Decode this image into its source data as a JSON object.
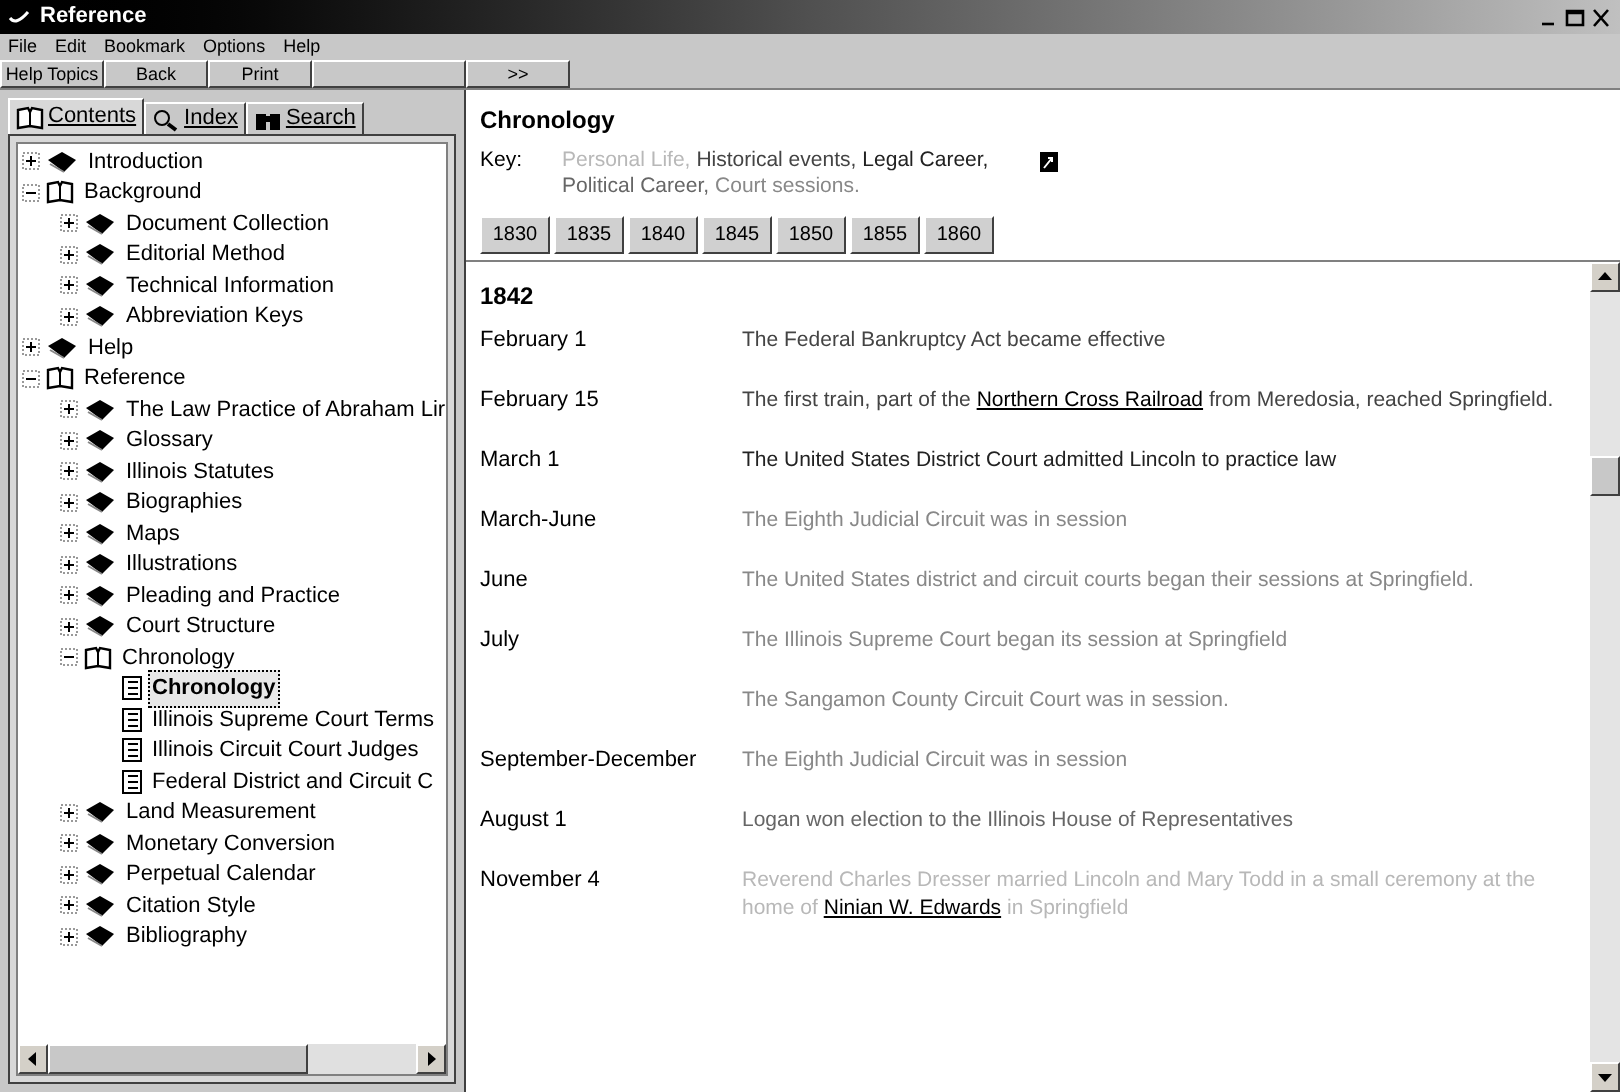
{
  "window": {
    "title": "Reference"
  },
  "menu": [
    "File",
    "Edit",
    "Bookmark",
    "Options",
    "Help"
  ],
  "toolbar": [
    "Help Topics",
    "Back",
    "Print",
    ">>"
  ],
  "tabs": [
    {
      "label": "Contents",
      "selected": true
    },
    {
      "label": "Index",
      "selected": false
    },
    {
      "label": "Search",
      "selected": false
    }
  ],
  "tree": [
    {
      "label": "Introduction",
      "kind": "book",
      "expanded": false,
      "selected": false
    },
    {
      "label": "Background",
      "kind": "book",
      "expanded": true,
      "selected": false,
      "children": [
        {
          "label": "Document Collection",
          "kind": "book",
          "expanded": false,
          "selected": false
        },
        {
          "label": "Editorial Method",
          "kind": "book",
          "expanded": false,
          "selected": false
        },
        {
          "label": "Technical Information",
          "kind": "book",
          "expanded": false,
          "selected": false
        },
        {
          "label": "Abbreviation Keys",
          "kind": "book",
          "expanded": false,
          "selected": false
        }
      ]
    },
    {
      "label": "Help",
      "kind": "book",
      "expanded": false,
      "selected": false
    },
    {
      "label": "Reference",
      "kind": "book",
      "expanded": true,
      "selected": false,
      "children": [
        {
          "label": "The Law Practice of Abraham Lir",
          "kind": "book",
          "expanded": false,
          "selected": false
        },
        {
          "label": "Glossary",
          "kind": "book",
          "expanded": false,
          "selected": false
        },
        {
          "label": "Illinois Statutes",
          "kind": "book",
          "expanded": false,
          "selected": false
        },
        {
          "label": "Biographies",
          "kind": "book",
          "expanded": false,
          "selected": false
        },
        {
          "label": "Maps",
          "kind": "book",
          "expanded": false,
          "selected": false
        },
        {
          "label": "Illustrations",
          "kind": "book",
          "expanded": false,
          "selected": false
        },
        {
          "label": "Pleading and Practice",
          "kind": "book",
          "expanded": false,
          "selected": false
        },
        {
          "label": "Court Structure",
          "kind": "book",
          "expanded": false,
          "selected": false
        },
        {
          "label": "Chronology",
          "kind": "book",
          "expanded": true,
          "selected": false,
          "children": [
            {
              "label": "Chronology",
              "kind": "page",
              "selected": true
            },
            {
              "label": "Illinois Supreme Court Terms",
              "kind": "page",
              "selected": false
            },
            {
              "label": "Illinois Circuit Court Judges",
              "kind": "page",
              "selected": false
            },
            {
              "label": "Federal District and Circuit C",
              "kind": "page",
              "selected": false
            }
          ]
        },
        {
          "label": "Land Measurement",
          "kind": "book",
          "expanded": false,
          "selected": false
        },
        {
          "label": "Monetary Conversion",
          "kind": "book",
          "expanded": false,
          "selected": false
        },
        {
          "label": "Perpetual Calendar",
          "kind": "book",
          "expanded": false,
          "selected": false
        },
        {
          "label": "Citation Style",
          "kind": "book",
          "expanded": false,
          "selected": false
        },
        {
          "label": "Bibliography",
          "kind": "book",
          "expanded": false,
          "selected": false
        }
      ]
    }
  ],
  "topic": {
    "title": "Chronology",
    "key_label": "Key:",
    "key_items": [
      {
        "text": "Personal Life,",
        "color": "#b8b8b8"
      },
      {
        "text": "Historical events,",
        "color": "#444444"
      },
      {
        "text": "Legal Career,",
        "color": "#222222"
      },
      {
        "text": "Political Career,",
        "color": "#666666"
      },
      {
        "text": "Court sessions.",
        "color": "#888888"
      }
    ],
    "years": [
      "1830",
      "1835",
      "1840",
      "1845",
      "1850",
      "1855",
      "1860"
    ]
  },
  "content": {
    "year": "1842",
    "events": [
      {
        "date": "February 1",
        "text": "The Federal Bankruptcy Act became effective",
        "color": "#444444"
      },
      {
        "date": "February 15",
        "text": "The first train, part of the ",
        "link": "Northern Cross Railroad",
        "after": " from Meredosia, reached Springfield.",
        "color": "#444444"
      },
      {
        "date": "March 1",
        "text": "The United States District Court admitted Lincoln to practice law",
        "color": "#222222"
      },
      {
        "date": "March-June",
        "text": "The Eighth Judicial Circuit was in session",
        "color": "#888888"
      },
      {
        "date": "June",
        "text": "The United States district and circuit courts began their sessions at Springfield.",
        "color": "#888888"
      },
      {
        "date": "July",
        "text": "The Illinois Supreme Court began its session at Springfield",
        "color": "#888888"
      },
      {
        "text": "The Sangamon County Circuit Court was in session.",
        "color": "#888888"
      },
      {
        "date": "September-December",
        "text": "The Eighth Judicial Circuit was in session",
        "color": "#888888"
      },
      {
        "date": "August 1",
        "text": "Logan won election to the Illinois House of Representatives",
        "color": "#666666"
      },
      {
        "date": "November 4",
        "text": "Reverend Charles Dresser married Lincoln and Mary Todd in a small ceremony at the home of ",
        "link": "Ninian W. Edwards",
        "after": " in Springfield",
        "color": "#b8b8b8"
      }
    ]
  }
}
